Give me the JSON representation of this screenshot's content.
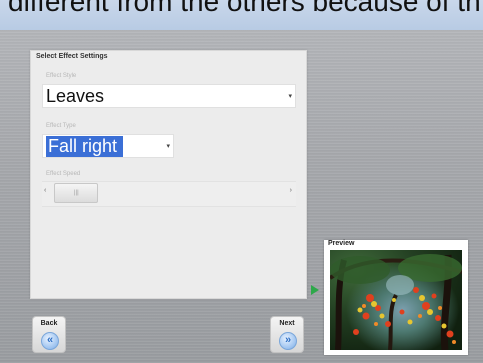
{
  "caption_text": "different from the others because of th",
  "panel": {
    "title": "Select Effect Settings",
    "effect_style_label": "Effect Style",
    "effect_style_value": "Leaves",
    "effect_type_label": "Effect Type",
    "effect_type_value": "Fall right",
    "effect_speed_label": "Effect Speed"
  },
  "preview": {
    "title": "Preview"
  },
  "nav": {
    "back_label": "Back",
    "next_label": "Next"
  },
  "colors": {
    "selection": "#3b6fd6",
    "play_arrow": "#2ea84a",
    "nav_icon": "#2f6fc3"
  },
  "icons": {
    "back": "double-chevron-left-icon",
    "next": "double-chevron-right-icon",
    "play": "play-triangle-icon",
    "dropdown": "dropdown-arrow-icon"
  }
}
